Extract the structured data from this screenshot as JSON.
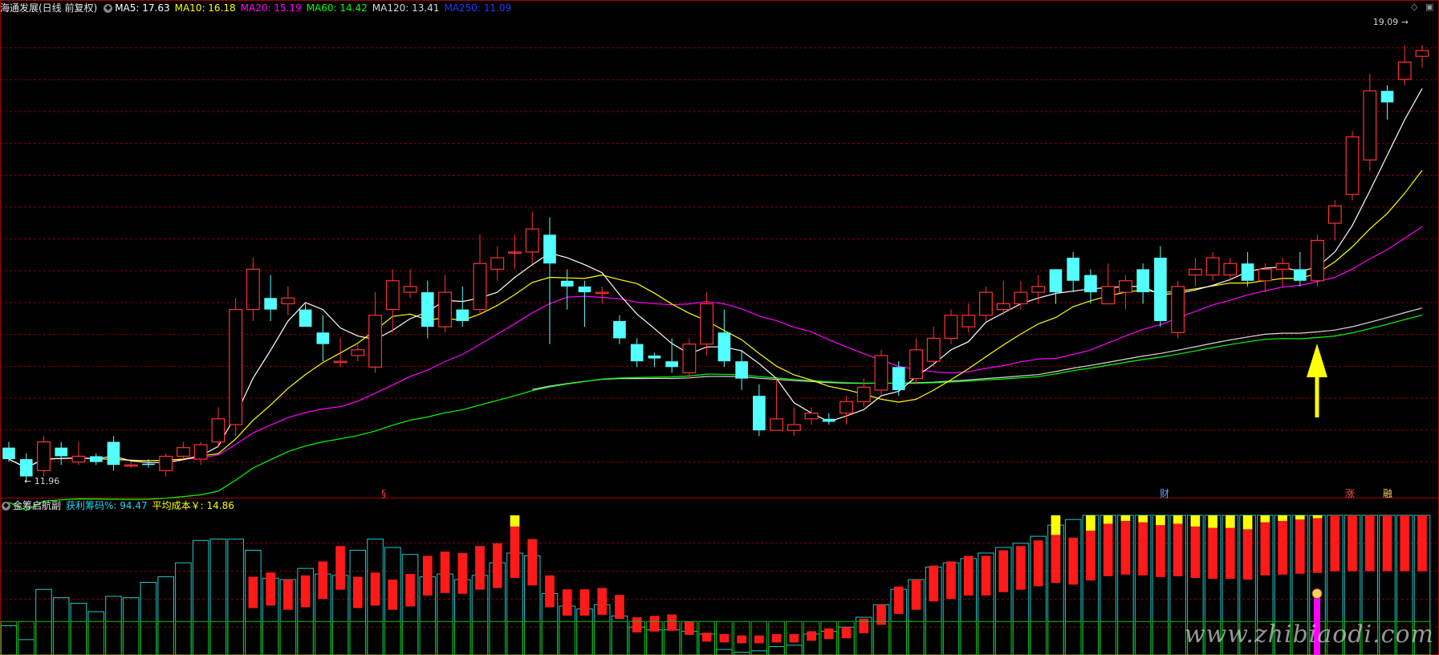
{
  "main_legend": {
    "title": "海通发展(日线 前复权)",
    "items": [
      {
        "label": "MA5: 17.63",
        "color": "#ffffff"
      },
      {
        "label": "MA10: 16.18",
        "color": "#ffff00"
      },
      {
        "label": "MA20: 15.19",
        "color": "#ff00ff"
      },
      {
        "label": "MA60: 14.42",
        "color": "#00ff00"
      },
      {
        "label": "MA120: 13.41",
        "color": "#d8d8d8"
      },
      {
        "label": "MA250: 11.09",
        "color": "#1e3cff"
      }
    ]
  },
  "sub_legend": {
    "title": "金筹启航副",
    "items": [
      {
        "label": "获利筹码%: 94.47",
        "color": "#22d3ee"
      },
      {
        "label": "平均成本￥: 14.86",
        "color": "#ffff00"
      }
    ]
  },
  "markers": {
    "low_price": "11.96",
    "high_price": "19.09",
    "s_mark": "§",
    "cai_mark": "财",
    "zhang_mark": "涨",
    "rong_mark": "融"
  },
  "watermark": "www.zhibiaodi.com",
  "colors": {
    "up": "#ff3232",
    "down": "#54ffff",
    "grid": "#8b0000",
    "ma5": "#ffffff",
    "ma10": "#ffff00",
    "ma20": "#ff00ff",
    "ma60": "#00ff00",
    "ma120": "#d8d8d8",
    "arrow": "#ffff00"
  },
  "chart_data": [
    {
      "type": "candlestick",
      "ylim": [
        11.3,
        19.6
      ],
      "candles": [
        [
          12.1,
          11.9,
          12.2,
          11.85
        ],
        [
          11.9,
          11.6,
          12.0,
          11.5
        ],
        [
          11.7,
          12.2,
          12.3,
          11.6
        ],
        [
          12.1,
          11.95,
          12.2,
          11.8
        ],
        [
          11.85,
          11.95,
          12.2,
          11.8
        ],
        [
          11.95,
          11.85,
          12.0,
          11.8
        ],
        [
          12.2,
          11.8,
          12.3,
          11.7
        ],
        [
          11.8,
          11.8,
          11.85,
          11.75
        ],
        [
          11.82,
          11.8,
          11.9,
          11.75
        ],
        [
          11.7,
          11.95,
          12.0,
          11.6
        ],
        [
          11.95,
          12.1,
          12.2,
          11.9
        ],
        [
          11.9,
          12.15,
          12.2,
          11.8
        ],
        [
          12.2,
          12.6,
          12.8,
          12.1
        ],
        [
          12.5,
          14.5,
          14.7,
          12.3
        ],
        [
          14.5,
          15.2,
          15.4,
          14.3
        ],
        [
          14.7,
          14.5,
          15.1,
          14.3
        ],
        [
          14.6,
          14.7,
          14.9,
          14.4
        ],
        [
          14.5,
          14.2,
          14.6,
          14.2
        ],
        [
          14.1,
          13.9,
          14.4,
          13.6
        ],
        [
          13.6,
          13.6,
          14.0,
          13.5
        ],
        [
          13.7,
          13.8,
          13.9,
          13.6
        ],
        [
          13.5,
          14.4,
          14.8,
          13.4
        ],
        [
          14.5,
          15.0,
          15.2,
          14.1
        ],
        [
          14.8,
          14.9,
          15.2,
          14.7
        ],
        [
          14.8,
          14.2,
          15.0,
          14.0
        ],
        [
          14.2,
          14.8,
          15.1,
          14.1
        ],
        [
          14.5,
          14.3,
          14.9,
          14.2
        ],
        [
          14.5,
          15.3,
          15.8,
          14.4
        ],
        [
          15.2,
          15.4,
          15.6,
          15.0
        ],
        [
          15.5,
          15.5,
          15.8,
          15.2
        ],
        [
          15.5,
          15.9,
          16.2,
          15.3
        ],
        [
          15.8,
          15.3,
          16.1,
          13.9
        ],
        [
          15.0,
          14.9,
          15.2,
          14.5
        ],
        [
          14.9,
          14.8,
          15.0,
          14.2
        ],
        [
          14.8,
          14.8,
          14.9,
          14.6
        ],
        [
          14.3,
          14.0,
          14.4,
          13.9
        ],
        [
          13.9,
          13.6,
          14.0,
          13.5
        ],
        [
          13.7,
          13.65,
          13.75,
          13.5
        ],
        [
          13.6,
          13.5,
          14.0,
          13.4
        ],
        [
          13.4,
          13.9,
          14.0,
          13.3
        ],
        [
          13.9,
          14.6,
          14.8,
          13.7
        ],
        [
          14.1,
          13.6,
          14.5,
          13.5
        ],
        [
          13.6,
          13.3,
          13.8,
          13.1
        ],
        [
          13.0,
          12.4,
          13.2,
          12.3
        ],
        [
          12.4,
          12.6,
          13.3,
          12.4
        ],
        [
          12.4,
          12.5,
          12.8,
          12.3
        ],
        [
          12.6,
          12.7,
          12.8,
          12.5
        ],
        [
          12.6,
          12.55,
          12.7,
          12.5
        ],
        [
          12.7,
          12.9,
          13.0,
          12.5
        ],
        [
          12.9,
          13.15,
          13.3,
          12.8
        ],
        [
          13.1,
          13.7,
          13.8,
          13.0
        ],
        [
          13.5,
          13.1,
          13.6,
          13.0
        ],
        [
          13.3,
          13.8,
          14.0,
          13.2
        ],
        [
          13.6,
          14.0,
          14.2,
          13.5
        ],
        [
          14.0,
          14.4,
          14.5,
          13.9
        ],
        [
          14.2,
          14.4,
          14.6,
          14.1
        ],
        [
          14.4,
          14.8,
          14.9,
          14.3
        ],
        [
          14.5,
          14.6,
          15.0,
          14.4
        ],
        [
          14.6,
          14.8,
          15.0,
          14.5
        ],
        [
          14.8,
          14.9,
          15.1,
          14.6
        ],
        [
          15.2,
          14.8,
          15.2,
          14.6
        ],
        [
          15.4,
          15.0,
          15.5,
          14.8
        ],
        [
          15.1,
          14.8,
          15.2,
          14.6
        ],
        [
          14.6,
          14.9,
          15.3,
          14.6
        ],
        [
          14.8,
          15.0,
          15.1,
          14.5
        ],
        [
          15.2,
          14.8,
          15.3,
          14.6
        ],
        [
          15.4,
          14.3,
          15.6,
          14.2
        ],
        [
          14.1,
          14.9,
          15.0,
          14.0
        ],
        [
          15.1,
          15.2,
          15.4,
          14.9
        ],
        [
          15.1,
          15.4,
          15.5,
          15.0
        ],
        [
          15.1,
          15.3,
          15.4,
          15.0
        ],
        [
          15.3,
          15.0,
          15.5,
          14.9
        ],
        [
          15.0,
          15.2,
          15.3,
          14.8
        ],
        [
          15.2,
          15.3,
          15.4,
          14.9
        ],
        [
          15.2,
          15.0,
          15.5,
          14.9
        ],
        [
          15.0,
          15.7,
          15.8,
          14.9
        ],
        [
          16.0,
          16.3,
          16.4,
          15.7
        ],
        [
          16.5,
          17.5,
          17.6,
          16.4
        ],
        [
          17.1,
          18.3,
          18.6,
          16.9
        ],
        [
          18.3,
          18.1,
          18.4,
          17.8
        ],
        [
          18.5,
          18.8,
          19.09,
          18.4
        ],
        [
          18.9,
          19.0,
          19.1,
          18.7
        ]
      ]
    },
    {
      "type": "bar",
      "ylim": [
        0,
        100
      ],
      "outline": [
        21,
        11,
        47,
        41,
        37,
        31,
        42,
        41,
        52,
        56,
        66,
        82,
        83,
        83,
        75,
        55,
        54,
        62,
        58,
        57,
        75,
        83,
        77,
        72,
        56,
        58,
        54,
        57,
        66,
        73,
        71,
        44,
        35,
        33,
        36,
        28,
        20,
        18,
        18,
        17,
        15,
        4,
        2,
        3,
        6,
        7,
        15,
        17,
        20,
        27,
        36,
        47,
        54,
        63,
        66,
        69,
        73,
        77,
        80,
        85,
        93,
        97,
        100,
        100,
        100,
        100,
        100,
        100,
        100,
        100,
        100,
        100,
        100,
        100,
        100,
        100,
        100,
        100,
        100,
        100,
        100,
        100
      ],
      "red_bar": [
        0,
        0,
        0,
        0,
        0,
        0,
        0,
        0,
        0,
        0,
        0,
        0,
        0,
        0,
        56,
        59,
        54,
        57,
        67,
        78,
        56,
        59,
        54,
        58,
        71,
        74,
        73,
        78,
        80,
        92,
        83,
        57,
        47,
        47,
        48,
        43,
        27,
        28,
        29,
        24,
        16,
        15,
        14,
        14,
        15,
        15,
        17,
        19,
        20,
        26,
        36,
        49,
        54,
        64,
        67,
        71,
        71,
        75,
        78,
        82,
        86,
        84,
        89,
        94,
        96,
        95,
        93,
        94,
        92,
        91,
        91,
        90,
        95,
        96,
        97,
        98,
        100,
        100,
        100,
        100,
        100,
        100
      ],
      "yellow_bar": [
        0,
        0,
        0,
        0,
        0,
        0,
        0,
        0,
        0,
        0,
        0,
        0,
        0,
        0,
        0,
        0,
        0,
        0,
        0,
        0,
        0,
        0,
        0,
        0,
        0,
        0,
        0,
        0,
        0,
        0,
        0,
        0,
        0,
        0,
        0,
        0,
        0,
        0,
        0,
        0,
        0,
        0,
        0,
        0,
        0,
        0,
        0,
        0,
        0,
        0,
        0,
        0,
        0,
        0,
        0,
        0,
        0,
        0,
        0,
        0,
        0,
        0,
        0,
        0,
        0,
        0,
        0,
        0,
        0,
        0,
        0,
        0,
        0,
        0,
        0,
        0,
        0,
        0,
        0,
        0,
        0,
        0
      ]
    }
  ]
}
